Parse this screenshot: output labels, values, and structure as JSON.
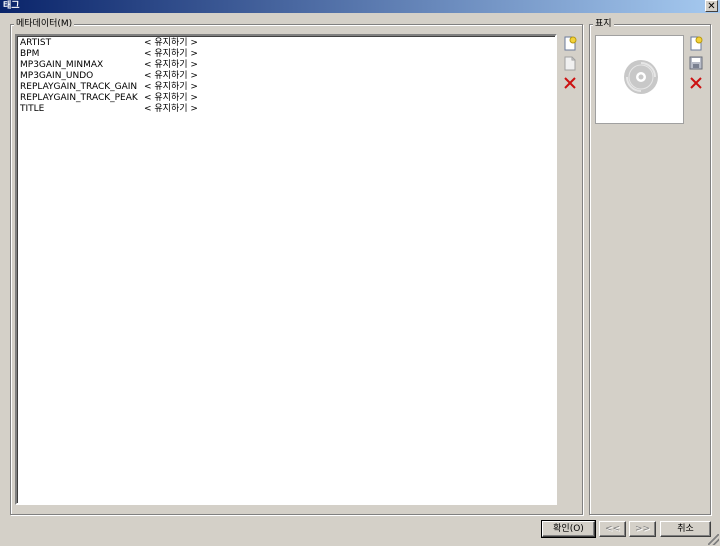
{
  "window": {
    "title": "태그",
    "close_glyph": "✕"
  },
  "metadata_group": {
    "label": "메타데이터(M)",
    "rows": [
      {
        "key": "ARTIST",
        "value": "< 유지하기 >"
      },
      {
        "key": "BPM",
        "value": "< 유지하기 >"
      },
      {
        "key": "MP3GAIN_MINMAX",
        "value": "< 유지하기 >"
      },
      {
        "key": "MP3GAIN_UNDO",
        "value": "< 유지하기 >"
      },
      {
        "key": "REPLAYGAIN_TRACK_GAIN",
        "value": "< 유지하기 >"
      },
      {
        "key": "REPLAYGAIN_TRACK_PEAK",
        "value": "< 유지하기 >"
      },
      {
        "key": "TITLE",
        "value": "< 유지하기 >"
      }
    ],
    "tools": [
      "add-field-icon",
      "edit-field-icon",
      "remove-field-icon"
    ]
  },
  "cover_group": {
    "label": "표지",
    "placeholder_icon": "cd-disc-icon",
    "tools": [
      "load-image-icon",
      "save-image-icon",
      "remove-image-icon"
    ]
  },
  "footer": {
    "ok_label": "확인(O)",
    "prev_label": "<<",
    "next_label": ">>",
    "cancel_label": "취소"
  },
  "colors": {
    "dialog_bg": "#d4d0c8",
    "titlebar_start": "#0a246a",
    "titlebar_end": "#a6caf0",
    "delete_red": "#cc1111"
  }
}
